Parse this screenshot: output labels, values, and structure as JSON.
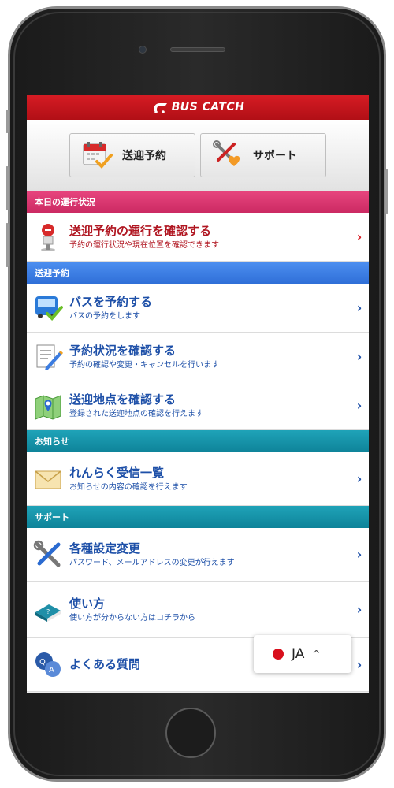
{
  "header": {
    "brand": "BUS CATCH"
  },
  "tabs": [
    {
      "label": "送迎予約",
      "icon": "calendar-check-icon"
    },
    {
      "label": "サポート",
      "icon": "tools-heart-icon"
    }
  ],
  "sections": {
    "today": "本日の運行状況",
    "reservation": "送迎予約",
    "notice": "お知らせ",
    "support": "サポート"
  },
  "items": {
    "operation": {
      "title": "送迎予約の運行を確認する",
      "sub": "予約の運行状況や現在位置を確認できます",
      "icon": "bus-stop-icon"
    },
    "reserve": {
      "title": "バスを予約する",
      "sub": "バスの予約をします",
      "icon": "bus-check-icon"
    },
    "status": {
      "title": "予約状況を確認する",
      "sub": "予約の確認や変更・キャンセルを行います",
      "icon": "document-pen-icon"
    },
    "points": {
      "title": "送迎地点を確認する",
      "sub": "登録された送迎地点の確認を行えます",
      "icon": "map-pin-icon"
    },
    "inbox": {
      "title": "れんらく受信一覧",
      "sub": "お知らせの内容の確認を行えます",
      "icon": "envelope-icon"
    },
    "settings": {
      "title": "各種設定変更",
      "sub": "パスワード、メールアドレスの変更が行えます",
      "icon": "tools-icon"
    },
    "howto": {
      "title": "使い方",
      "sub": "使い方が分からない方はコチラから",
      "icon": "book-icon"
    },
    "faq": {
      "title": "よくある質問",
      "sub": "",
      "icon": "qa-icon"
    }
  },
  "chevron": "›",
  "language": {
    "code": "JA",
    "caret": "^"
  },
  "colors": {
    "brand_red": "#d71c24",
    "link_blue": "#1e50a8",
    "pink": "#e8457e",
    "blue": "#4d8ff0",
    "teal": "#1fa3b8"
  }
}
